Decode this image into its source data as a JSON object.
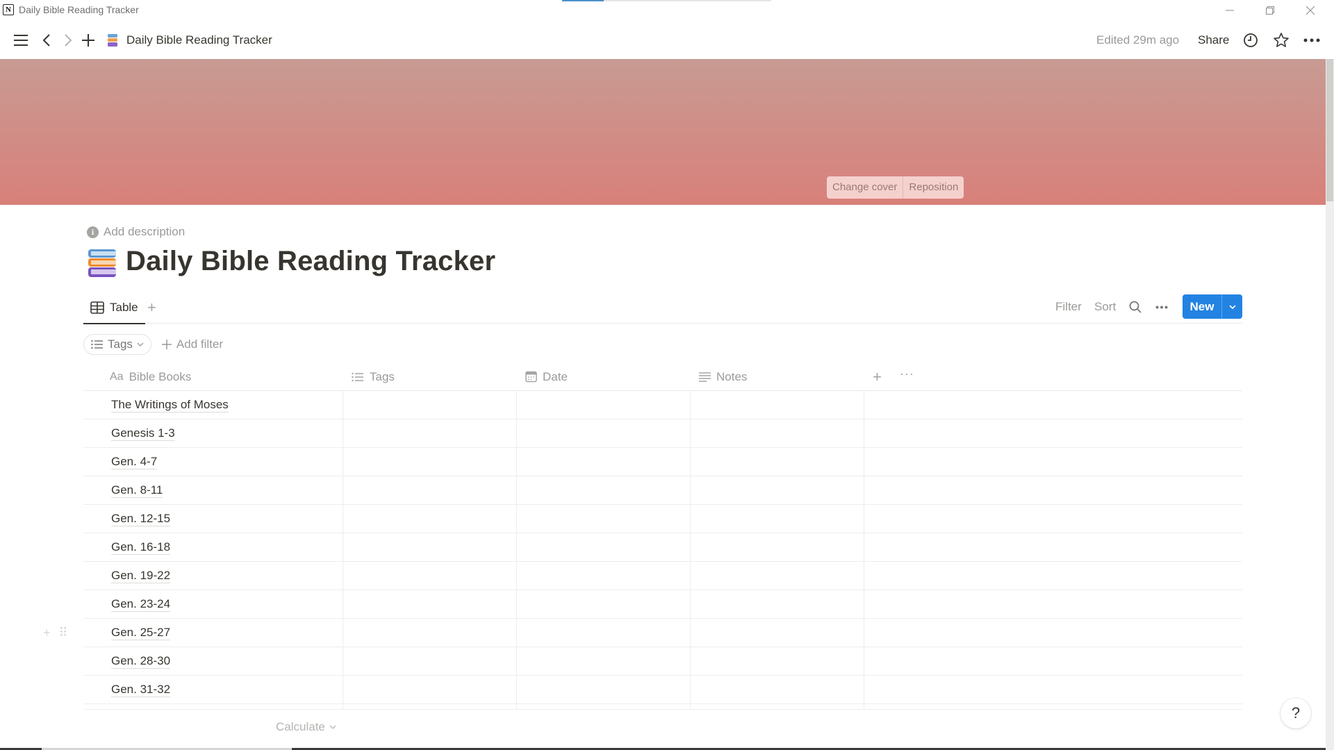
{
  "window": {
    "title": "Daily Bible Reading Tracker",
    "loading_progress": 0.2
  },
  "topnav": {
    "breadcrumb": "Daily Bible Reading Tracker",
    "edited": "Edited 29m ago",
    "share_label": "Share"
  },
  "cover": {
    "change_cover_label": "Change cover",
    "reposition_label": "Reposition",
    "gradient_top": "#c79b93",
    "gradient_bottom": "#d9807a"
  },
  "page": {
    "add_description": "Add description",
    "title": "Daily Bible Reading Tracker",
    "title_icon": "books-emoji"
  },
  "views": {
    "tabs": [
      {
        "label": "Table",
        "icon": "table-icon",
        "active": true
      }
    ],
    "filter_label": "Filter",
    "sort_label": "Sort",
    "new_label": "New",
    "accent_color": "#2383e2"
  },
  "filters": {
    "chips": [
      {
        "label": "Tags",
        "icon": "list-icon"
      }
    ],
    "add_filter_label": "Add filter"
  },
  "table": {
    "columns": [
      {
        "label": "Bible Books",
        "icon": "Aa"
      },
      {
        "label": "Tags",
        "icon": "list-icon"
      },
      {
        "label": "Date",
        "icon": "calendar-icon"
      },
      {
        "label": "Notes",
        "icon": "text-lines-icon"
      }
    ],
    "rows": [
      {
        "title": "The Writings of Moses",
        "tags": "",
        "date": "",
        "notes": ""
      },
      {
        "title": "Genesis 1-3",
        "tags": "",
        "date": "",
        "notes": ""
      },
      {
        "title": "Gen. 4-7",
        "tags": "",
        "date": "",
        "notes": ""
      },
      {
        "title": "Gen. 8-11",
        "tags": "",
        "date": "",
        "notes": ""
      },
      {
        "title": "Gen. 12-15",
        "tags": "",
        "date": "",
        "notes": ""
      },
      {
        "title": "Gen. 16-18",
        "tags": "",
        "date": "",
        "notes": ""
      },
      {
        "title": "Gen. 19-22",
        "tags": "",
        "date": "",
        "notes": ""
      },
      {
        "title": "Gen. 23-24",
        "tags": "",
        "date": "",
        "notes": ""
      },
      {
        "title": "Gen. 25-27",
        "tags": "",
        "date": "",
        "notes": ""
      },
      {
        "title": "Gen. 28-30",
        "tags": "",
        "date": "",
        "notes": ""
      },
      {
        "title": "Gen. 31-32",
        "tags": "",
        "date": "",
        "notes": ""
      }
    ],
    "calculate_label": "Calculate"
  },
  "help": {
    "label": "?"
  }
}
